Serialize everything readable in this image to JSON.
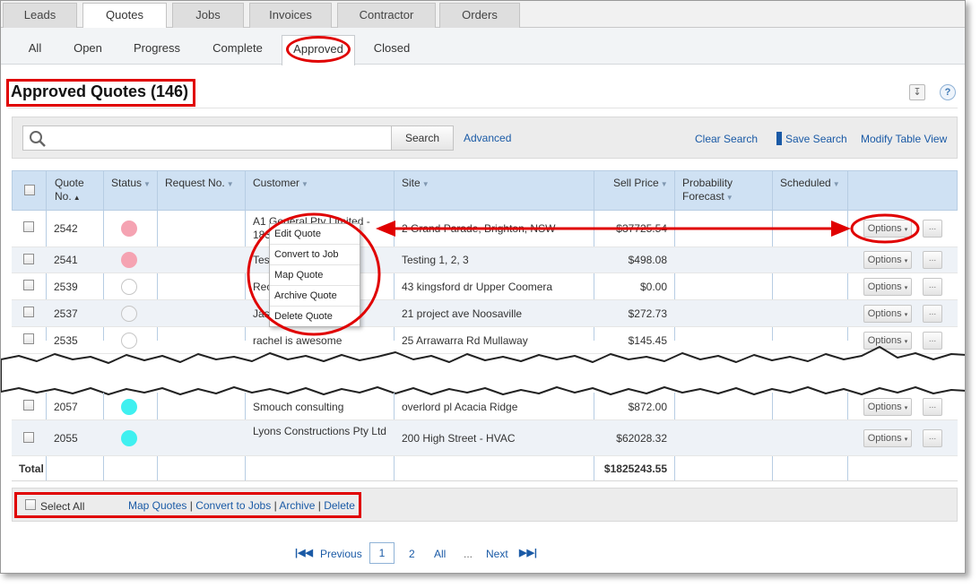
{
  "tabs": [
    "Leads",
    "Quotes",
    "Jobs",
    "Invoices",
    "Contractor",
    "Orders"
  ],
  "sub_tabs": [
    "All",
    "Open",
    "Progress",
    "Complete",
    "Approved",
    "Closed"
  ],
  "page_title": "Approved Quotes (146)",
  "toolbar": {
    "download_icon": "download-icon",
    "help_symbol": "?"
  },
  "search": {
    "value": "",
    "placeholder": "",
    "button": "Search",
    "advanced": "Advanced",
    "clear": "Clear Search",
    "save": "Save Search",
    "modify": "Modify Table View"
  },
  "columns": [
    "Quote No.",
    "Status",
    "Request No.",
    "Customer",
    "Site",
    "Sell Price",
    "Probability Forecast",
    "Scheduled"
  ],
  "rows": [
    {
      "quote_no": "2542",
      "status_color": "#f5a3b2",
      "request_no": "",
      "customer": "A1 General Pty Limited - 183",
      "site": "2 Grand Parade, Brighton, NSW",
      "price": "$37725.54",
      "options": "Options",
      "more": "..."
    },
    {
      "quote_no": "2541",
      "status_color": "#f5a3b2",
      "request_no": "",
      "customer": "Tes",
      "site": "Testing 1, 2, 3",
      "price": "$498.08",
      "options": "Options",
      "more": "..."
    },
    {
      "quote_no": "2539",
      "status_color": "#ffffff",
      "request_no": "",
      "customer": "Rec",
      "site": "43 kingsford dr Upper Coomera",
      "price": "$0.00",
      "options": "Options",
      "more": "..."
    },
    {
      "quote_no": "2537",
      "status_color": "#ffffff",
      "request_no": "",
      "customer": "Jas",
      "site": "21 project ave Noosaville",
      "price": "$272.73",
      "options": "Options",
      "more": "..."
    },
    {
      "quote_no": "2535",
      "status_color": "#ffffff",
      "request_no": "",
      "customer": "rachel is awesome",
      "site": "25 Arrawarra Rd Mullaway",
      "price": "$145.45",
      "options": "Options",
      "more": "..."
    },
    {
      "quote_no": "2057",
      "status_color": "#3ff0f0",
      "request_no": "",
      "customer": "Smouch consulting",
      "site": "overlord pl Acacia Ridge",
      "price": "$872.00",
      "options": "Options",
      "more": "..."
    },
    {
      "quote_no": "2055",
      "status_color": "#3ff0f0",
      "request_no": "",
      "customer": "Lyons Constructions Pty Ltd",
      "site": "200 High Street - HVAC",
      "price": "$62028.32",
      "options": "Options",
      "more": "..."
    }
  ],
  "total": {
    "label": "Total",
    "value": "$1825243.55"
  },
  "context_menu": [
    "Edit Quote",
    "Convert to Job",
    "Map Quote",
    "Archive Quote",
    "Delete Quote"
  ],
  "bulk": {
    "select_all": "Select All",
    "actions": [
      "Map Quotes",
      "Convert to Jobs",
      "Archive",
      "Delete"
    ],
    "separator": "|"
  },
  "pagination": {
    "first_icon": "first-page-icon",
    "prev": "Previous",
    "pages": [
      "1",
      "2"
    ],
    "current": "1",
    "all": "All",
    "ellipsis": "...",
    "next": "Next",
    "last_icon": "last-page-icon"
  },
  "colors": {
    "annotation": "#e00000",
    "link": "#1a5aa6",
    "header_bg": "#cfe1f3"
  }
}
